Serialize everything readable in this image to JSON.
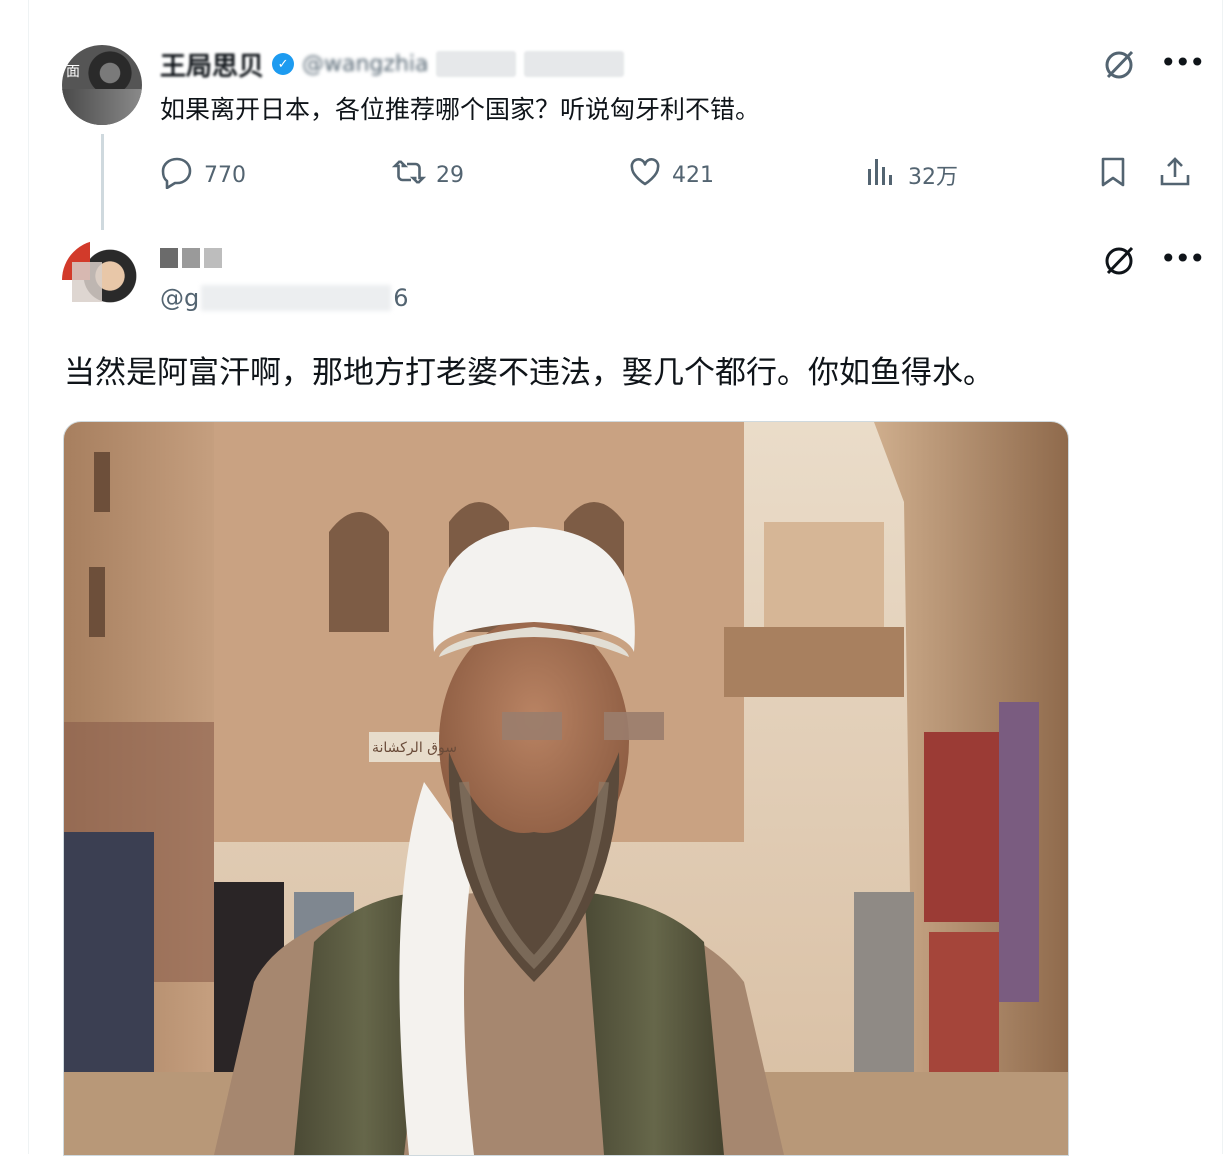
{
  "parent_tweet": {
    "author_name": "王局思贝",
    "handle": "@wangzhia",
    "text": "如果离开日本，各位推荐哪个国家？听说匈牙利不错。",
    "replies": "770",
    "retweets": "29",
    "likes": "421",
    "views": "32万"
  },
  "reply_tweet": {
    "author_name": "",
    "handle_prefix": "@g",
    "handle_suffix": "6",
    "text": "当然是阿富汗啊，那地方打老婆不违法，娶几个都行。你如鱼得水。",
    "media_sign": "ﺳﻮﻕ ﺍﻟﺮﻛﺸﺎﻧﺔ"
  },
  "icons": {
    "reply": "reply-icon",
    "retweet": "retweet-icon",
    "like": "heart-icon",
    "views": "analytics-icon",
    "bookmark": "bookmark-icon",
    "share": "share-icon",
    "grok": "grok-icon",
    "more": "more-icon"
  },
  "colors": {
    "text": "#0f1419",
    "secondary": "#536471",
    "verified": "#1d9bf0",
    "border": "#cfd9de"
  }
}
